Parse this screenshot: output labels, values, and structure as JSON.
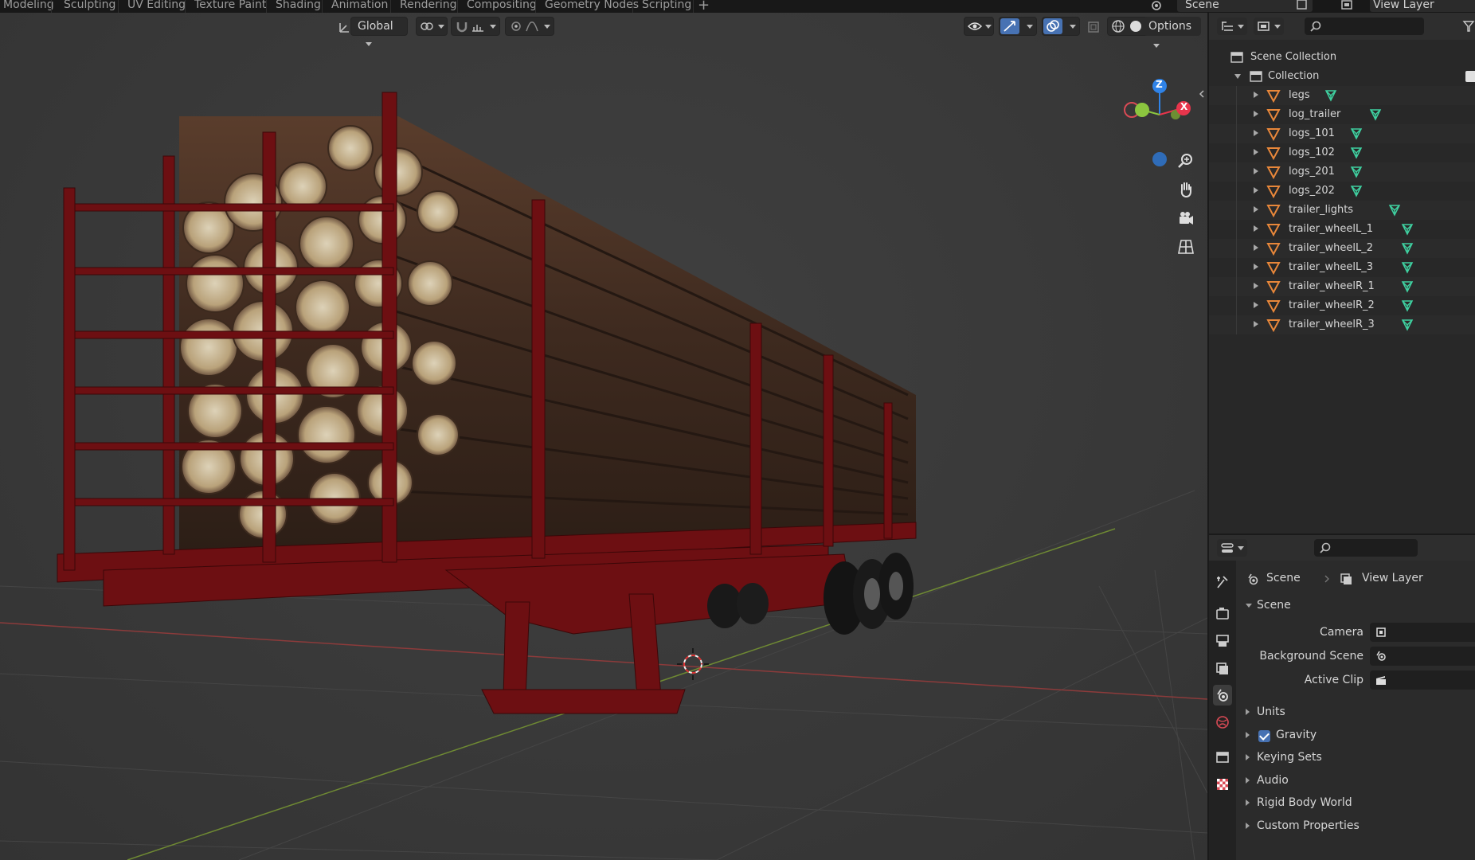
{
  "workspace_tabs": [
    "Modeling",
    "Sculpting",
    "UV Editing",
    "Texture Paint",
    "Shading",
    "Animation",
    "Rendering",
    "Compositing",
    "Geometry Nodes",
    "Scripting"
  ],
  "scene_selector": "Scene",
  "view_layer_selector": "View Layer",
  "viewport": {
    "transform_orientation": "Global",
    "options_label": "Options",
    "gizmo": {
      "z_label": "Z",
      "x_label": "X",
      "z_color": "#2f83e8",
      "x_color": "#e8354c",
      "y_color": "#8cc63f"
    }
  },
  "outliner": {
    "root": "Scene Collection",
    "collection": "Collection",
    "objects": [
      "legs",
      "log_trailer",
      "logs_101",
      "logs_102",
      "logs_201",
      "logs_202",
      "trailer_lights",
      "trailer_wheelL_1",
      "trailer_wheelL_2",
      "trailer_wheelL_3",
      "trailer_wheelR_1",
      "trailer_wheelR_2",
      "trailer_wheelR_3"
    ],
    "mesh_icon_color": "#e8873a",
    "data_icon_color": "#3fd0a0"
  },
  "properties": {
    "breadcrumb_scene": "Scene",
    "breadcrumb_view_layer": "View Layer",
    "section": "Scene",
    "fields": {
      "camera": "Camera",
      "background_scene": "Background Scene",
      "active_clip": "Active Clip"
    },
    "panels": {
      "units": "Units",
      "gravity": "Gravity",
      "keying_sets": "Keying Sets",
      "audio": "Audio",
      "rigid_body_world": "Rigid Body World",
      "custom_properties": "Custom Properties"
    }
  }
}
